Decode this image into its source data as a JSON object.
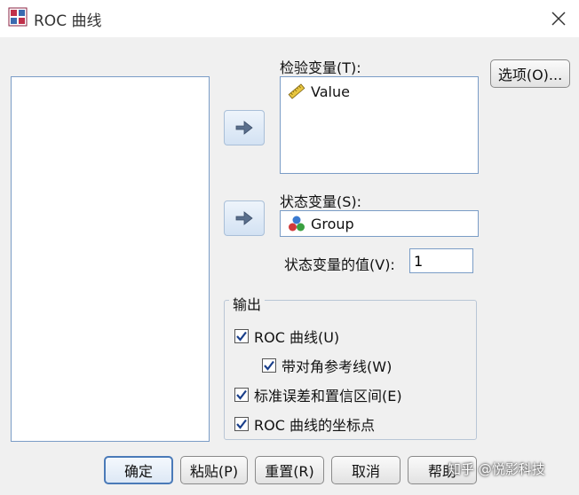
{
  "window": {
    "title": "ROC 曲线"
  },
  "colors": {
    "accent": "#4a7ab8",
    "check": "#1a3f8a",
    "list_border": "#7a9cc6"
  },
  "test_variable": {
    "label": "检验变量(T):",
    "items": [
      {
        "name": "Value",
        "icon": "ruler-icon"
      }
    ]
  },
  "state_variable": {
    "label": "状态变量(S):",
    "value": "Group",
    "icon": "nominal-variable-icon"
  },
  "state_value": {
    "label": "状态变量的值(V):",
    "value": "1"
  },
  "options_button": "选项(O)...",
  "output": {
    "title": "输出",
    "checkboxes": [
      {
        "label": "ROC 曲线(U)",
        "checked": true
      },
      {
        "label": "带对角参考线(W)",
        "checked": true
      },
      {
        "label": "标准误差和置信区间(E)",
        "checked": true
      },
      {
        "label": "ROC 曲线的坐标点",
        "checked": true
      }
    ]
  },
  "buttons": {
    "ok": "确定",
    "paste": "粘贴(P)",
    "reset": "重置(R)",
    "cancel": "取消",
    "help": "帮助"
  },
  "watermark": "知乎 @悦影科技"
}
